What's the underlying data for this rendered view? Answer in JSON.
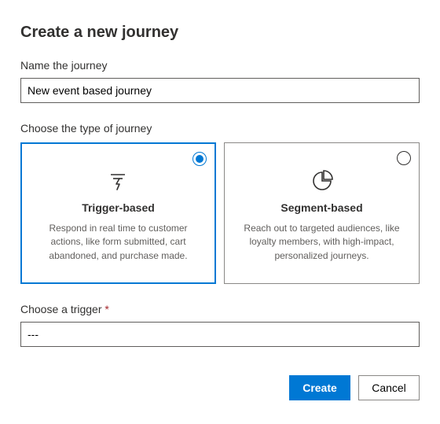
{
  "title": "Create a new journey",
  "name_field": {
    "label": "Name the journey",
    "value": "New event based journey"
  },
  "type_section": {
    "label": "Choose the type of journey",
    "options": [
      {
        "title": "Trigger-based",
        "desc": "Respond in real time to customer actions, like form submitted, cart abandoned, and purchase made.",
        "selected": true
      },
      {
        "title": "Segment-based",
        "desc": "Reach out to targeted audiences, like loyalty members, with high-impact, personalized journeys.",
        "selected": false
      }
    ]
  },
  "trigger_field": {
    "label_text": "Choose a trigger ",
    "required_marker": "*",
    "value": "---"
  },
  "buttons": {
    "create": "Create",
    "cancel": "Cancel"
  }
}
